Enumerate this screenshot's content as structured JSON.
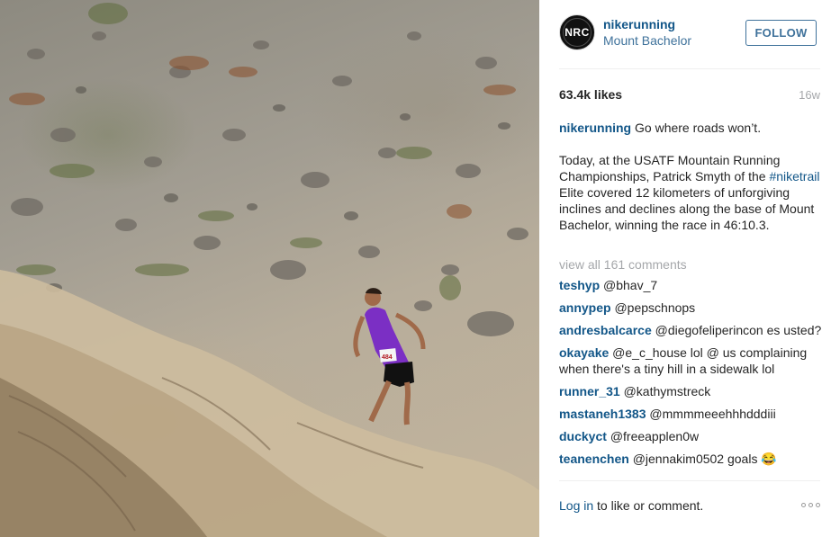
{
  "post": {
    "photo_alt": "",
    "account": {
      "username": "nikerunning",
      "avatar_text": "NRC",
      "location": "Mount Bachelor"
    },
    "follow_label": "FOLLOW",
    "likes": "63.4k likes",
    "age": "16w",
    "caption": {
      "username": "nikerunning",
      "line1": "Go where roads won’t.",
      "para_before_tag": "Today, at the USATF Mountain Running Championships, Patrick Smyth of the",
      "hashtag": "#niketrail",
      "para_after_tag": "Elite covered 12 kilometers of unforgiving inclines and declines along the base of Mount Bachelor, winning the race in 46:10.3."
    },
    "view_all": "view all 161 comments",
    "comments": [
      {
        "user": "teshyp",
        "text": "@bhav_7"
      },
      {
        "user": "annypep",
        "text": "@pepschnops"
      },
      {
        "user": "andresbalcarce",
        "text": "@diegofeliperincon es usted?"
      },
      {
        "user": "okayake",
        "text": "@e_c_house lol @ us complaining when there's a tiny hill in a sidewalk lol"
      },
      {
        "user": "runner_31",
        "text": "@kathymstreck"
      },
      {
        "user": "mastaneh1383",
        "text": "@mmmmeeehhhdddiii"
      },
      {
        "user": "duckyct",
        "text": "@freeapplen0w"
      },
      {
        "user": "teanenchen",
        "text": "@jennakim0502 goals 😂"
      }
    ],
    "footer": {
      "login": "Log in",
      "rest": "to like or comment."
    },
    "bib_number": "484",
    "colors": {
      "link": "#125688",
      "follow": "#3f729b",
      "muted": "#a5a7aa",
      "singlet": "#7b2fc4"
    }
  }
}
